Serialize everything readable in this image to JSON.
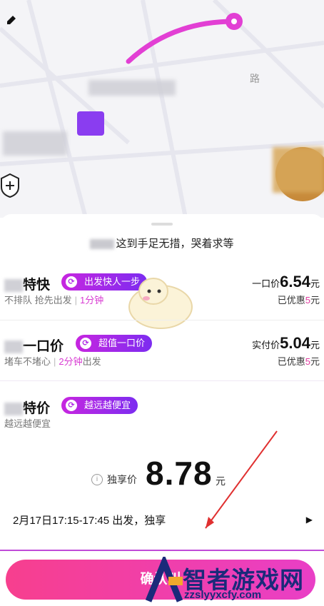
{
  "map": {
    "road_label": "路",
    "shield_icon": "shield-plus-icon",
    "pin_icon": "destination-pin-icon",
    "pencil_icon": "edit-icon"
  },
  "notice": {
    "text": "这到手足无措，哭着求等"
  },
  "options": [
    {
      "title": "特快",
      "badge": "出发快人一步",
      "sub_a": "不排队 抢先出发",
      "sub_b": "1分钟",
      "price_label": "一口价",
      "price": "6.54",
      "unit": "元",
      "discount_prefix": "已优惠",
      "discount": "5",
      "discount_unit": "元"
    },
    {
      "title": "一口价",
      "badge": "超值一口价",
      "sub_a": "堵车不堵心",
      "sub_b": "2分钟",
      "sub_c": "出发",
      "price_label": "实付价",
      "price": "5.04",
      "unit": "元",
      "discount_prefix": "已优惠",
      "discount": "5",
      "discount_unit": "元"
    },
    {
      "title": "特价",
      "badge": "越远越便宜",
      "sub_a": "越远越便宜"
    }
  ],
  "selected": {
    "price_label": "独享价",
    "price": "8.78",
    "unit": "元",
    "departure": "2月17日17:15-17:45 出发，独享"
  },
  "confirm": {
    "label": "确认叫"
  },
  "watermark": {
    "title": "智者游戏网",
    "url": "zzslyyxcfy.com"
  },
  "colors": {
    "accent": "#c726e0",
    "confirm": "#f0409c",
    "watermark": "#1b2a7a"
  }
}
